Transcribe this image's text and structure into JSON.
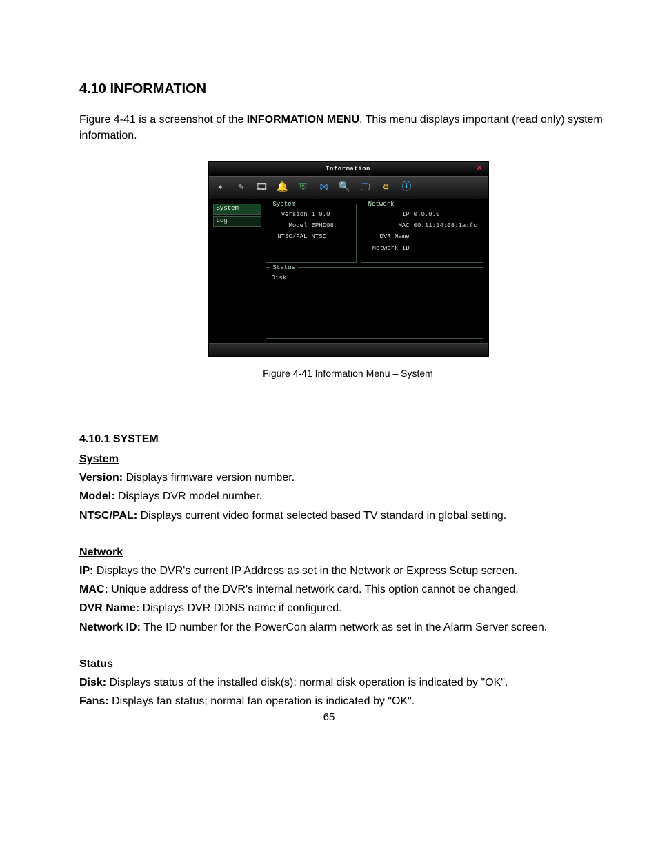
{
  "section_title": "4.10 INFORMATION",
  "intro_parts": {
    "pre": "Figure 4-41 is a screenshot of the ",
    "mid_bold": "INFORMATION MENU",
    "post": ". This menu displays important (read only) system information."
  },
  "caption": "Figure 4-41 Information Menu – System",
  "page_number": "65",
  "dvr": {
    "title": "Information",
    "toolbar_icons": [
      "wand",
      "brush",
      "film",
      "bell",
      "shield",
      "net",
      "search",
      "monitor",
      "gear",
      "info"
    ],
    "sidebar": [
      {
        "label": "System",
        "selected": true
      },
      {
        "label": "Log",
        "selected": false
      }
    ],
    "panels": {
      "system": {
        "legend": "System",
        "rows": [
          {
            "k": "Version",
            "v": "1.0.0"
          },
          {
            "k": "Model",
            "v": "EPHD08"
          },
          {
            "k": "NTSC/PAL",
            "v": "NTSC"
          }
        ]
      },
      "network": {
        "legend": "Network",
        "rows": [
          {
            "k": "IP",
            "v": "0.0.0.0"
          },
          {
            "k": "MAC",
            "v": "00:11:14:08:1a:fc"
          },
          {
            "k": "DVR Name",
            "v": ""
          },
          {
            "k": "Network ID",
            "v": ""
          }
        ]
      },
      "status": {
        "legend": "Status",
        "rows": [
          {
            "k": "Disk",
            "v": ""
          }
        ]
      }
    }
  },
  "groups": {
    "system": {
      "heading": "4.10.1 SYSTEM",
      "sub": "System",
      "items": [
        {
          "label": "Version:",
          "text": " Displays firmware version number."
        },
        {
          "label": "Model:",
          "text": " Displays DVR model number."
        },
        {
          "label": "NTSC/PAL:",
          "text": " Displays current video format selected based TV standard in global setting."
        }
      ]
    },
    "network": {
      "sub": "Network",
      "items": [
        {
          "label": "IP:",
          "text": " Displays the DVR's current IP Address as set in the Network or Express Setup screen."
        },
        {
          "label": "MAC:",
          "text": " Unique address of the DVR's internal network card. This option cannot be changed."
        },
        {
          "label": "DVR Name:",
          "text": " Displays DVR DDNS name if configured."
        },
        {
          "label": "Network ID:",
          "text": " The ID number for the PowerCon alarm network as set in the Alarm Server screen."
        }
      ]
    },
    "status": {
      "sub": "Status",
      "items": [
        {
          "label": "Disk:",
          "text": " Displays status of the installed disk(s); normal disk operation is indicated by \"OK\"."
        },
        {
          "label": "Fans:",
          "text": " Displays fan status; normal fan operation is indicated by \"OK\"."
        }
      ]
    }
  }
}
